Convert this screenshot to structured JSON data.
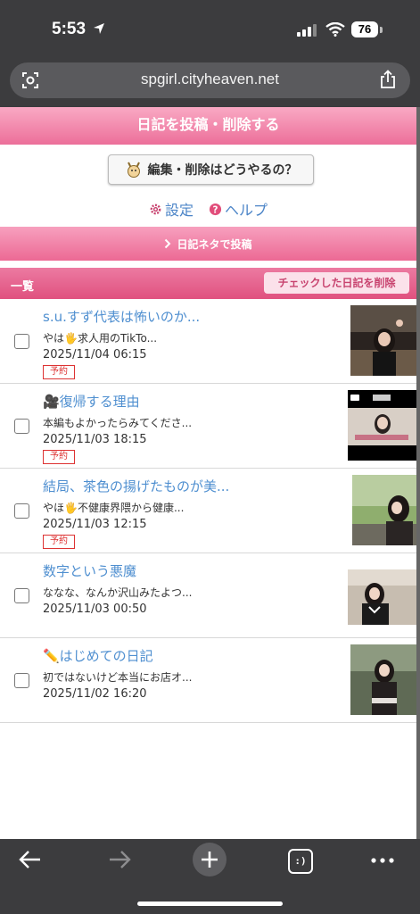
{
  "status_bar": {
    "time": "5:53",
    "battery": "76"
  },
  "browser": {
    "url": "spgirl.cityheaven.net",
    "tabs_label": ":)"
  },
  "page": {
    "header": "日記を投稿・削除する",
    "help_button": "編集・削除はどうやるの？",
    "settings_link": "設定",
    "help_link": "ヘルプ",
    "neta_link": "日記ネタで投稿",
    "list_title": "一覧",
    "delete_checked": "チェックした日記を削除"
  },
  "entries": [
    {
      "title": "s.u.すず代表は怖いのか...",
      "excerpt": "やは🖐求人用のTikTo...",
      "date": "2025/11/04 06:15",
      "badge": "予約"
    },
    {
      "title": "🎥復帰する理由",
      "excerpt": "本編もよかったらみてくださ...",
      "date": "2025/11/03 18:15",
      "badge": "予約"
    },
    {
      "title": "結局、茶色の揚げたものが美...",
      "excerpt": "やほ🖐不健康界隈から健康...",
      "date": "2025/11/03 12:15",
      "badge": "予約"
    },
    {
      "title": "数字という悪魔",
      "excerpt": "ななな、なんか沢山みたよつ...",
      "date": "2025/11/03 00:50",
      "badge": ""
    },
    {
      "title": "✏️はじめての日記",
      "excerpt": "初ではないけど本当にお店オ...",
      "date": "2025/11/02 16:20",
      "badge": ""
    }
  ],
  "colors": {
    "accent_pink": "#ec6f9a",
    "link_blue": "#4f8fd0",
    "badge_red": "#dd3333"
  }
}
